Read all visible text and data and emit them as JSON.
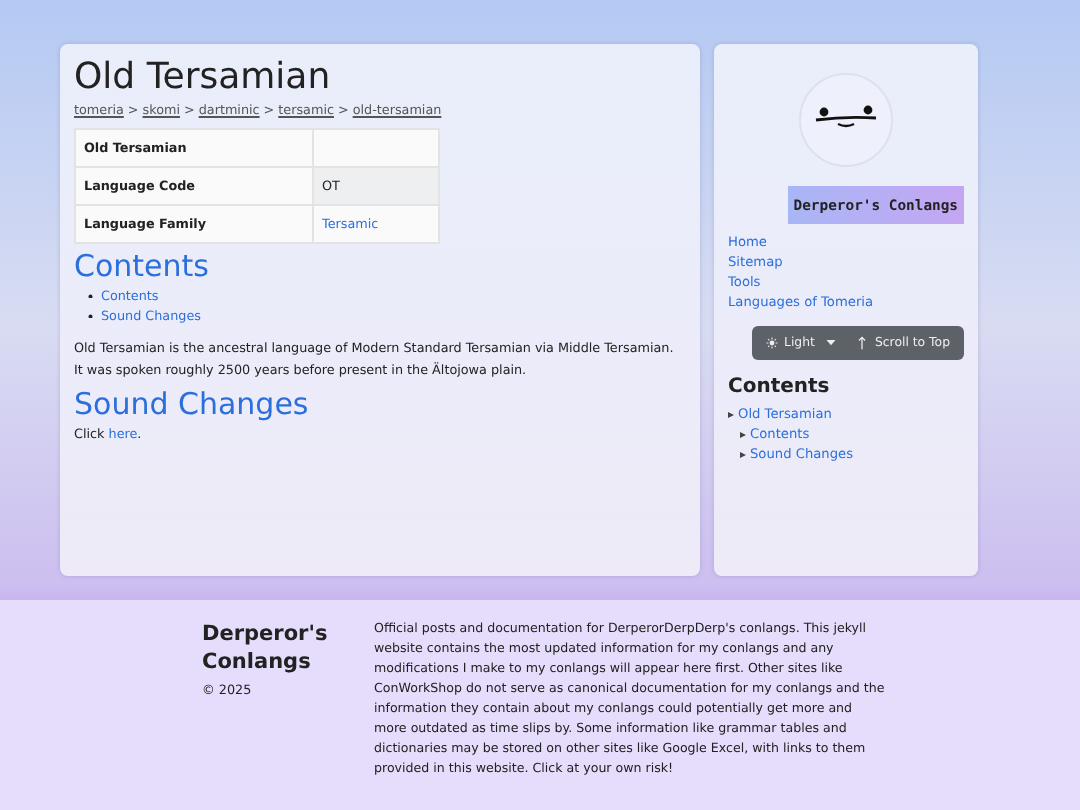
{
  "page": {
    "title": "Old Tersamian",
    "breadcrumb": {
      "separator": ">",
      "items": [
        "tomeria",
        "skomi",
        "dartminic",
        "tersamic",
        "old-tersamian"
      ]
    },
    "infobox": {
      "header": "Old Tersamian",
      "rows": [
        {
          "label": "Language Code",
          "value": "OT",
          "link": false
        },
        {
          "label": "Language Family",
          "value": "Tersamic",
          "link": true
        }
      ]
    },
    "contents_heading": "Contents",
    "contents_links": [
      "Contents",
      "Sound Changes"
    ],
    "intro": "Old Tersamian is the ancestral language of Modern Standard Tersamian via Middle Tersamian. It was spoken roughly 2500 years before present in the Ältojowa plain.",
    "section_heading": "Sound Changes",
    "section_text": {
      "before": "Click ",
      "link": "here",
      "after": "."
    }
  },
  "sidebar": {
    "site_title": "Derperor's Conlangs",
    "nav": [
      "Home",
      "Sitemap",
      "Tools",
      "Languages of Tomeria"
    ],
    "theme_button": "Light",
    "scroll_button": "Scroll to Top",
    "toc_heading": "Contents",
    "toc": [
      {
        "label": "Old Tersamian",
        "children": [
          {
            "label": "Contents"
          },
          {
            "label": "Sound Changes"
          }
        ]
      }
    ]
  },
  "footer": {
    "title": "Derperor's Conlangs",
    "copyright": "© 2025",
    "text": "Official posts and documentation for DerperorDerpDerp's conlangs. This jekyll website contains the most updated information for my conlangs and any modifications I make to my conlangs will appear here first. Other sites like ConWorkShop do not serve as canonical documentation for my conlangs and the information they contain about my conlangs could potentially get more and more outdated as time slips by. Some information like grammar tables and dictionaries may be stored on other sites like Google Excel, with links to them provided in this website. Click at your own risk!"
  }
}
